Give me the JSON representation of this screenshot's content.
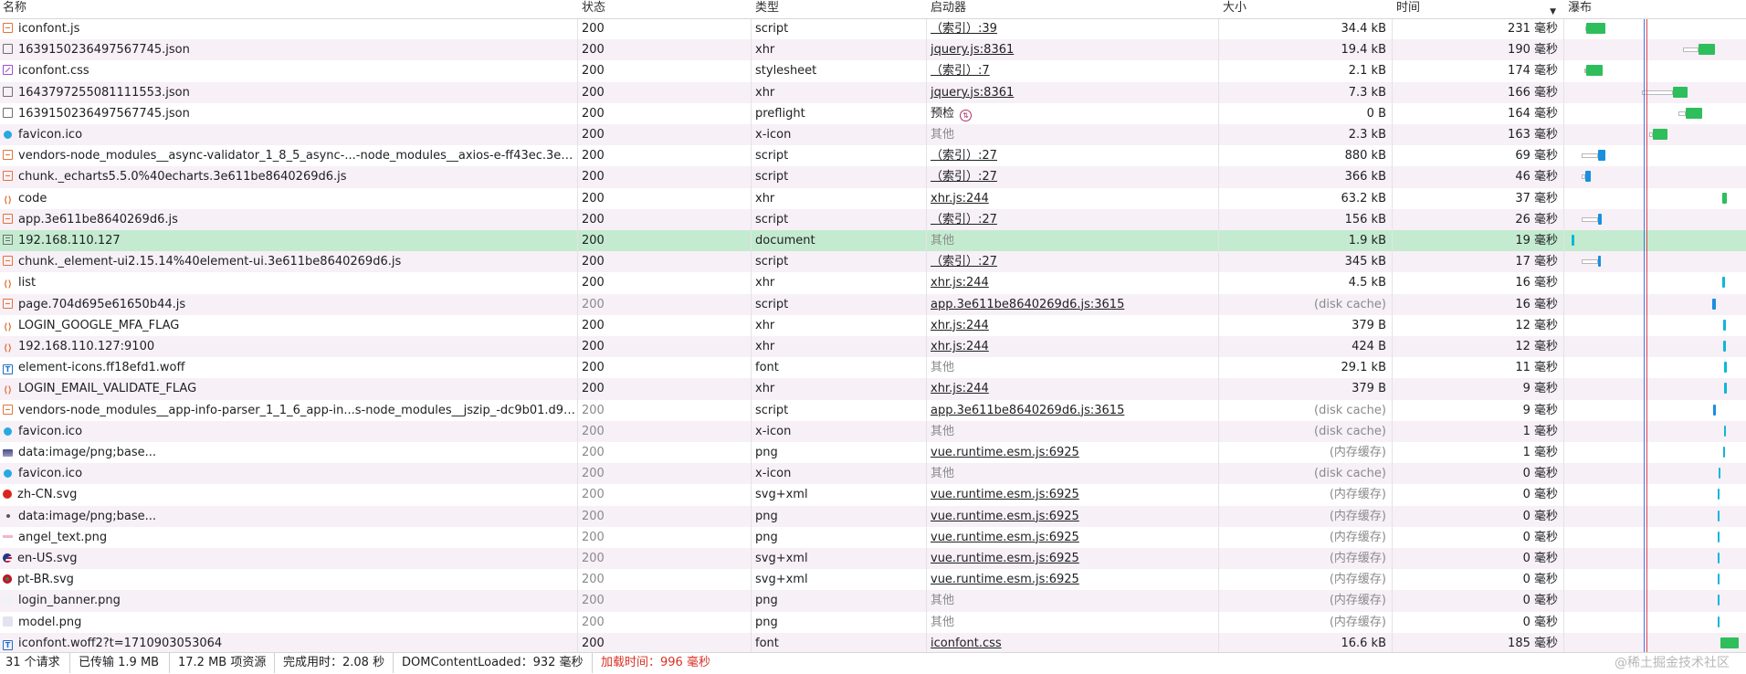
{
  "header": {
    "name": "名称",
    "status": "状态",
    "type": "类型",
    "initiator": "启动器",
    "size": "大小",
    "time": "时间",
    "waterfall": "瀑布"
  },
  "icons": {
    "js": "script-file-icon",
    "doc": "json-document-icon",
    "css": "stylesheet-file-icon",
    "xhr": "fetch-xhr-icon",
    "ico": "favicon-icon",
    "page": "html-document-icon",
    "font": "font-file-icon",
    "img": "image-thumbnail-icon",
    "flag-cn": "cn-flag-icon",
    "flag-us": "us-flag-icon",
    "flag-br": "br-flag-icon"
  },
  "colors": {
    "selected_row": "#c4ebd0",
    "alt_row": "#f7f0f7",
    "waterfall_green": "#2ebe5c",
    "waterfall_blue": "#1a8fde",
    "dom_content_line": "#4a6fe8",
    "load_line": "#e04848"
  },
  "rows": [
    {
      "name": "iconfont.js",
      "status": "200",
      "type": "script",
      "initiator": "（索引）:39",
      "initiator_link": true,
      "size": "34.4 kB",
      "time": "231 毫秒",
      "icon": "js",
      "wf": {
        "wait": [
          1736,
          1737
        ],
        "bar": [
          1737,
          1758
        ],
        "color": "green"
      }
    },
    {
      "name": "1639150236497567745.json",
      "status": "200",
      "type": "xhr",
      "initiator": "jquery.js:8361",
      "initiator_link": true,
      "size": "19.4 kB",
      "time": "190 毫秒",
      "icon": "doc",
      "wf": {
        "wait": [
          1843,
          1860
        ],
        "bar": [
          1860,
          1878
        ],
        "color": "green"
      }
    },
    {
      "name": "iconfont.css",
      "status": "200",
      "type": "stylesheet",
      "initiator": "（索引）:7",
      "initiator_link": true,
      "size": "2.1 kB",
      "time": "174 毫秒",
      "icon": "css",
      "wf": {
        "wait": [
          1735,
          1737
        ],
        "bar": [
          1737,
          1755
        ],
        "color": "green"
      }
    },
    {
      "name": "1643797255081111553.json",
      "status": "200",
      "type": "xhr",
      "initiator": "jquery.js:8361",
      "initiator_link": true,
      "size": "7.3 kB",
      "time": "166 毫秒",
      "icon": "doc",
      "wf": {
        "wait": [
          1798,
          1832
        ],
        "bar": [
          1832,
          1848
        ],
        "color": "green"
      }
    },
    {
      "name": "1639150236497567745.json",
      "status": "200",
      "type": "preflight",
      "initiator": "预检",
      "initiator_link": false,
      "preflight": true,
      "size": "0 B",
      "time": "164 毫秒",
      "icon": "doc",
      "wf": {
        "wait": [
          1838,
          1846
        ],
        "bar": [
          1846,
          1864
        ],
        "color": "green"
      }
    },
    {
      "name": "favicon.ico",
      "status": "200",
      "type": "x-icon",
      "initiator": "其他",
      "initiator_gray": true,
      "size": "2.3 kB",
      "time": "163 毫秒",
      "icon": "ico",
      "wf": {
        "wait": [
          1806,
          1810
        ],
        "bar": [
          1810,
          1826
        ],
        "color": "green"
      }
    },
    {
      "name": "vendors-node_modules__async-validator_1_8_5_async-...-node_modules__axios-e-ff43ec.3e61...",
      "status": "200",
      "type": "script",
      "initiator": "（索引）:27",
      "initiator_link": true,
      "size": "880 kB",
      "time": "69 毫秒",
      "icon": "js",
      "wf": {
        "wait": [
          1732,
          1750
        ],
        "bar": [
          1750,
          1758
        ],
        "color": "blue"
      }
    },
    {
      "name": "chunk._echarts5.5.0%40echarts.3e611be8640269d6.js",
      "status": "200",
      "type": "script",
      "initiator": "（索引）:27",
      "initiator_link": true,
      "size": "366 kB",
      "time": "46 毫秒",
      "icon": "js",
      "wf": {
        "wait": [
          1732,
          1736
        ],
        "bar": [
          1736,
          1742
        ],
        "color": "blue"
      }
    },
    {
      "name": "code",
      "status": "200",
      "type": "xhr",
      "initiator": "xhr.js:244",
      "initiator_link": true,
      "size": "63.2 kB",
      "time": "37 毫秒",
      "icon": "xhr",
      "wf": {
        "bar": [
          1886,
          1891
        ],
        "color": "green"
      }
    },
    {
      "name": "app.3e611be8640269d6.js",
      "status": "200",
      "type": "script",
      "initiator": "（索引）:27",
      "initiator_link": true,
      "size": "156 kB",
      "time": "26 毫秒",
      "icon": "js",
      "wf": {
        "wait": [
          1732,
          1750
        ],
        "bar": [
          1750,
          1754
        ],
        "color": "blue"
      }
    },
    {
      "name": "192.168.110.127",
      "status": "200",
      "type": "document",
      "initiator": "其他",
      "initiator_gray": true,
      "size": "1.9 kB",
      "time": "19 毫秒",
      "icon": "page",
      "selected": true,
      "wf": {
        "bar": [
          1721,
          1724
        ],
        "color": "cyan"
      }
    },
    {
      "name": "chunk._element-ui2.15.14%40element-ui.3e611be8640269d6.js",
      "status": "200",
      "type": "script",
      "initiator": "（索引）:27",
      "initiator_link": true,
      "size": "345 kB",
      "time": "17 毫秒",
      "icon": "js",
      "wf": {
        "wait": [
          1732,
          1750
        ],
        "bar": [
          1750,
          1753
        ],
        "color": "blue"
      }
    },
    {
      "name": "list",
      "status": "200",
      "type": "xhr",
      "initiator": "xhr.js:244",
      "initiator_link": true,
      "size": "4.5 kB",
      "time": "16 毫秒",
      "icon": "xhr",
      "wf": {
        "bar": [
          1886,
          1889
        ],
        "color": "cyan"
      }
    },
    {
      "name": "page.704d695e61650b44.js",
      "status": "200",
      "status_gray": true,
      "type": "script",
      "initiator": "app.3e611be8640269d6.js:3615",
      "initiator_link": true,
      "size": "(disk cache)",
      "size_gray": true,
      "time": "16 毫秒",
      "icon": "js",
      "wf": {
        "bar": [
          1875,
          1879
        ],
        "color": "blue"
      }
    },
    {
      "name": "LOGIN_GOOGLE_MFA_FLAG",
      "status": "200",
      "type": "xhr",
      "initiator": "xhr.js:244",
      "initiator_link": true,
      "size": "379 B",
      "time": "12 毫秒",
      "icon": "xhr",
      "wf": {
        "bar": [
          1887,
          1890
        ],
        "color": "cyan"
      }
    },
    {
      "name": "192.168.110.127:9100",
      "status": "200",
      "type": "xhr",
      "initiator": "xhr.js:244",
      "initiator_link": true,
      "size": "424 B",
      "time": "12 毫秒",
      "icon": "xhr",
      "wf": {
        "bar": [
          1887,
          1890
        ],
        "color": "cyan"
      }
    },
    {
      "name": "element-icons.ff18efd1.woff",
      "status": "200",
      "type": "font",
      "initiator": "其他",
      "initiator_gray": true,
      "size": "29.1 kB",
      "time": "11 毫秒",
      "icon": "font",
      "wf": {
        "bar": [
          1888,
          1891
        ],
        "color": "cyan"
      }
    },
    {
      "name": "LOGIN_EMAIL_VALIDATE_FLAG",
      "status": "200",
      "type": "xhr",
      "initiator": "xhr.js:244",
      "initiator_link": true,
      "size": "379 B",
      "time": "9 毫秒",
      "icon": "xhr",
      "wf": {
        "bar": [
          1888,
          1891
        ],
        "color": "cyan"
      }
    },
    {
      "name": "vendors-node_modules__app-info-parser_1_1_6_app-in...s-node_modules__jszip_-dc9b01.d9a...",
      "status": "200",
      "status_gray": true,
      "type": "script",
      "initiator": "app.3e611be8640269d6.js:3615",
      "initiator_link": true,
      "size": "(disk cache)",
      "size_gray": true,
      "time": "9 毫秒",
      "icon": "js",
      "wf": {
        "bar": [
          1876,
          1879
        ],
        "color": "blue"
      }
    },
    {
      "name": "favicon.ico",
      "status": "200",
      "status_gray": true,
      "type": "x-icon",
      "initiator": "其他",
      "initiator_gray": true,
      "size": "(disk cache)",
      "size_gray": true,
      "time": "1 毫秒",
      "icon": "ico",
      "wf": {
        "bar": [
          1888,
          1890
        ],
        "color": "cyan"
      }
    },
    {
      "name": "data:image/png;base...",
      "status": "200",
      "status_gray": true,
      "type": "png",
      "initiator": "vue.runtime.esm.js:6925",
      "initiator_link": true,
      "size": "(内存缓存)",
      "size_gray": true,
      "time": "1 毫秒",
      "icon": "img",
      "wf": {
        "bar": [
          1887,
          1889
        ],
        "color": "cyan"
      }
    },
    {
      "name": "favicon.ico",
      "status": "200",
      "status_gray": true,
      "type": "x-icon",
      "initiator": "其他",
      "initiator_gray": true,
      "size": "(disk cache)",
      "size_gray": true,
      "time": "0 毫秒",
      "icon": "ico",
      "wf": {
        "bar": [
          1882,
          1884
        ],
        "color": "cyan"
      }
    },
    {
      "name": "zh-CN.svg",
      "status": "200",
      "status_gray": true,
      "type": "svg+xml",
      "initiator": "vue.runtime.esm.js:6925",
      "initiator_link": true,
      "size": "(内存缓存)",
      "size_gray": true,
      "time": "0 毫秒",
      "icon": "flag-cn",
      "wf": {
        "bar": [
          1881,
          1883
        ],
        "color": "cyan"
      }
    },
    {
      "name": "data:image/png;base...",
      "status": "200",
      "status_gray": true,
      "type": "png",
      "initiator": "vue.runtime.esm.js:6925",
      "initiator_link": true,
      "size": "(内存缓存)",
      "size_gray": true,
      "time": "0 毫秒",
      "icon": "dot",
      "wf": {
        "bar": [
          1881,
          1883
        ],
        "color": "cyan"
      }
    },
    {
      "name": "angel_text.png",
      "status": "200",
      "status_gray": true,
      "type": "png",
      "initiator": "vue.runtime.esm.js:6925",
      "initiator_link": true,
      "size": "(内存缓存)",
      "size_gray": true,
      "time": "0 毫秒",
      "icon": "pink",
      "wf": {
        "bar": [
          1881,
          1883
        ],
        "color": "cyan"
      }
    },
    {
      "name": "en-US.svg",
      "status": "200",
      "status_gray": true,
      "type": "svg+xml",
      "initiator": "vue.runtime.esm.js:6925",
      "initiator_link": true,
      "size": "(内存缓存)",
      "size_gray": true,
      "time": "0 毫秒",
      "icon": "flag-us",
      "wf": {
        "bar": [
          1881,
          1883
        ],
        "color": "cyan"
      }
    },
    {
      "name": "pt-BR.svg",
      "status": "200",
      "status_gray": true,
      "type": "svg+xml",
      "initiator": "vue.runtime.esm.js:6925",
      "initiator_link": true,
      "size": "(内存缓存)",
      "size_gray": true,
      "time": "0 毫秒",
      "icon": "flag-br",
      "wf": {
        "bar": [
          1881,
          1883
        ],
        "color": "cyan"
      }
    },
    {
      "name": "login_banner.png",
      "status": "200",
      "status_gray": true,
      "type": "png",
      "initiator": "其他",
      "initiator_gray": true,
      "size": "(内存缓存)",
      "size_gray": true,
      "time": "0 毫秒",
      "icon": "blank",
      "wf": {
        "bar": [
          1881,
          1883
        ],
        "color": "cyan"
      }
    },
    {
      "name": "model.png",
      "status": "200",
      "status_gray": true,
      "type": "png",
      "initiator": "其他",
      "initiator_gray": true,
      "size": "(内存缓存)",
      "size_gray": true,
      "time": "0 毫秒",
      "icon": "model",
      "wf": {
        "bar": [
          1881,
          1883
        ],
        "color": "cyan"
      }
    },
    {
      "name": "iconfont.woff2?t=1710903053064",
      "status": "200",
      "type": "font",
      "initiator": "iconfont.css",
      "initiator_link": true,
      "size": "16.6 kB",
      "time": "185 毫秒",
      "icon": "font",
      "wf": {
        "bar": [
          1884,
          1904
        ],
        "color": "green"
      }
    }
  ],
  "status_bar": {
    "requests": "31 个请求",
    "transferred": "已传输 1.9 MB",
    "resources": "17.2 MB 项资源",
    "finish": "完成用时：2.08 秒",
    "dcl": "DOMContentLoaded：932 毫秒",
    "load": "加载时间：996 毫秒",
    "watermark": "@稀土掘金技术社区"
  }
}
